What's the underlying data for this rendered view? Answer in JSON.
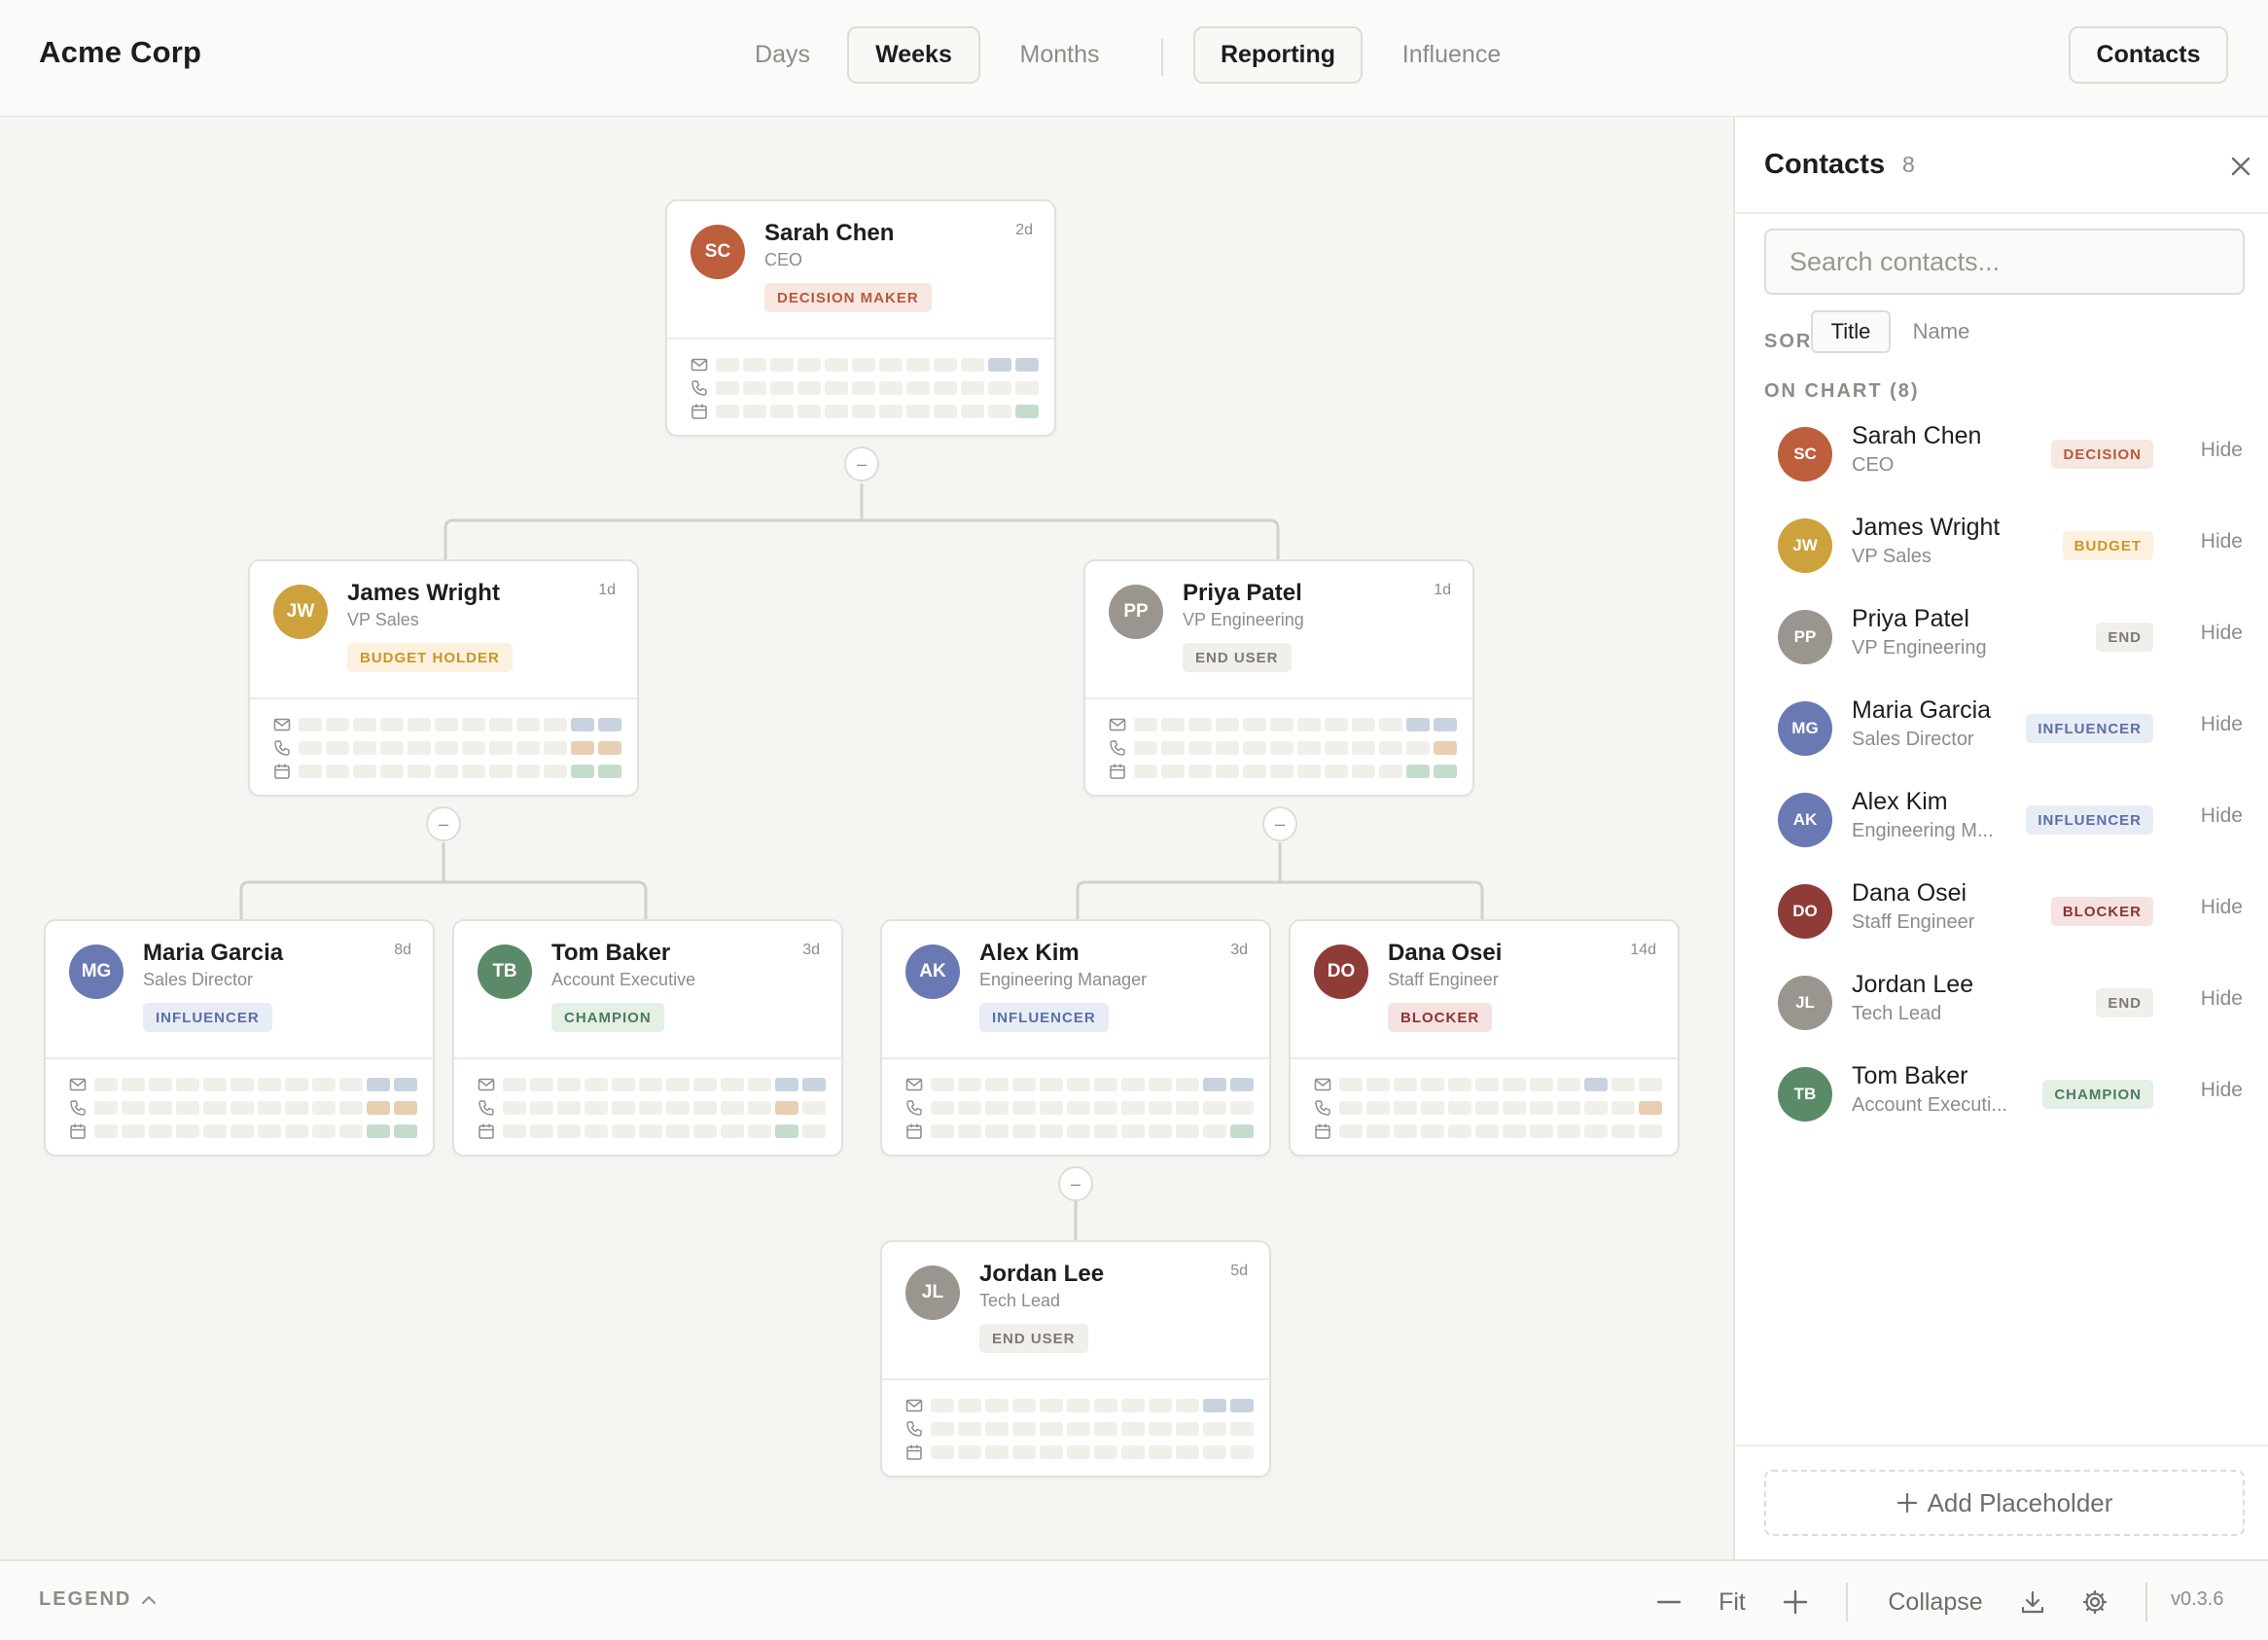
{
  "header": {
    "brand": "Acme Corp",
    "views": [
      {
        "label": "Days",
        "active": false
      },
      {
        "label": "Weeks",
        "active": true
      },
      {
        "label": "Months",
        "active": false
      }
    ],
    "modes": [
      {
        "label": "Reporting",
        "active": true
      },
      {
        "label": "Influence",
        "active": false
      }
    ],
    "contacts_button": "Contacts"
  },
  "colors": {
    "decision": {
      "fg": "#b8583c",
      "bg": "#f7e7e1"
    },
    "budget": {
      "fg": "#c9962a",
      "bg": "#fbf1de"
    },
    "end": {
      "fg": "#7d7a74",
      "bg": "#f0efeb"
    },
    "influencer": {
      "fg": "#5a6fa6",
      "bg": "#e8ecf5"
    },
    "champion": {
      "fg": "#4f7a5c",
      "bg": "#e4efe6"
    },
    "blocker": {
      "fg": "#8a3434",
      "bg": "#f6e3e1"
    },
    "activity_email": "#c9d3e0",
    "activity_call": "#e8cfb2",
    "activity_meeting": "#c5dccd"
  },
  "cards": [
    {
      "id": "sc",
      "initials": "SC",
      "name": "Sarah Chen",
      "title": "CEO",
      "age": "2d",
      "badge": "DECISION MAKER",
      "role": "decision",
      "avatar_color": "#bd5e3d"
    },
    {
      "id": "jw",
      "initials": "JW",
      "name": "James Wright",
      "title": "VP Sales",
      "age": "1d",
      "badge": "BUDGET HOLDER",
      "role": "budget",
      "avatar_color": "#cda23c"
    },
    {
      "id": "pp",
      "initials": "PP",
      "name": "Priya Patel",
      "title": "VP Engineering",
      "age": "1d",
      "badge": "END USER",
      "role": "end",
      "avatar_color": "#9a968f"
    },
    {
      "id": "mg",
      "initials": "MG",
      "name": "Maria Garcia",
      "title": "Sales Director",
      "age": "8d",
      "badge": "INFLUENCER",
      "role": "influencer",
      "avatar_color": "#6a79b4"
    },
    {
      "id": "tb",
      "initials": "TB",
      "name": "Tom Baker",
      "title": "Account Executive",
      "age": "3d",
      "badge": "CHAMPION",
      "role": "champion",
      "avatar_color": "#5b8a68"
    },
    {
      "id": "ak",
      "initials": "AK",
      "name": "Alex Kim",
      "title": "Engineering Manager",
      "age": "3d",
      "badge": "INFLUENCER",
      "role": "influencer",
      "avatar_color": "#6a79b4"
    },
    {
      "id": "do",
      "initials": "DO",
      "name": "Dana Osei",
      "title": "Staff Engineer",
      "age": "14d",
      "badge": "BLOCKER",
      "role": "blocker",
      "avatar_color": "#8f3b38"
    },
    {
      "id": "jl",
      "initials": "JL",
      "name": "Jordan Lee",
      "title": "Tech Lead",
      "age": "5d",
      "badge": "END USER",
      "role": "end",
      "avatar_color": "#9a968f"
    }
  ],
  "activity": {
    "sc": {
      "email": [
        10,
        11
      ],
      "call": [],
      "meeting": [
        11
      ]
    },
    "jw": {
      "email": [
        10,
        11
      ],
      "call": [
        10,
        11
      ],
      "meeting": [
        10,
        11
      ]
    },
    "pp": {
      "email": [
        10,
        11
      ],
      "call": [
        11
      ],
      "meeting": [
        10,
        11
      ]
    },
    "mg": {
      "email": [
        10,
        11
      ],
      "call": [
        10,
        11
      ],
      "meeting": [
        10,
        11
      ]
    },
    "tb": {
      "email": [
        10,
        11
      ],
      "call": [
        10
      ],
      "meeting": [
        10
      ]
    },
    "ak": {
      "email": [
        10,
        11
      ],
      "call": [],
      "meeting": [
        11
      ]
    },
    "do": {
      "email": [
        9
      ],
      "call": [
        11
      ],
      "meeting": []
    },
    "jl": {
      "email": [
        10,
        11
      ],
      "call": [],
      "meeting": []
    }
  },
  "toggle_symbol": "–",
  "panel": {
    "title": "Contacts",
    "count": "8",
    "search_placeholder": "Search contacts...",
    "sort_label": "SORT",
    "sort_options": [
      {
        "label": "Title",
        "active": true
      },
      {
        "label": "Name",
        "active": false
      }
    ],
    "section_label": "ON CHART (8)",
    "hide_label": "Hide",
    "contacts": [
      {
        "initials": "SC",
        "name": "Sarah Chen",
        "title": "CEO",
        "badge": "DECISION",
        "role": "decision",
        "avatar_color": "#bd5e3d"
      },
      {
        "initials": "JW",
        "name": "James Wright",
        "title": "VP Sales",
        "badge": "BUDGET",
        "role": "budget",
        "avatar_color": "#cda23c"
      },
      {
        "initials": "PP",
        "name": "Priya Patel",
        "title": "VP Engineering",
        "badge": "END",
        "role": "end",
        "avatar_color": "#9a968f"
      },
      {
        "initials": "MG",
        "name": "Maria Garcia",
        "title": "Sales Director",
        "badge": "INFLUENCER",
        "role": "influencer",
        "avatar_color": "#6a79b4"
      },
      {
        "initials": "AK",
        "name": "Alex Kim",
        "title": "Engineering M...",
        "badge": "INFLUENCER",
        "role": "influencer",
        "avatar_color": "#6a79b4"
      },
      {
        "initials": "DO",
        "name": "Dana Osei",
        "title": "Staff Engineer",
        "badge": "BLOCKER",
        "role": "blocker",
        "avatar_color": "#8f3b38"
      },
      {
        "initials": "JL",
        "name": "Jordan Lee",
        "title": "Tech Lead",
        "badge": "END",
        "role": "end",
        "avatar_color": "#9a968f"
      },
      {
        "initials": "TB",
        "name": "Tom Baker",
        "title": "Account Executi...",
        "badge": "CHAMPION",
        "role": "champion",
        "avatar_color": "#5b8a68"
      }
    ],
    "add_placeholder": "Add Placeholder"
  },
  "footer": {
    "legend": "LEGEND",
    "zoom_out": "—",
    "fit": "Fit",
    "zoom_in": "+",
    "collapse": "Collapse",
    "version": "v0.3.6"
  }
}
